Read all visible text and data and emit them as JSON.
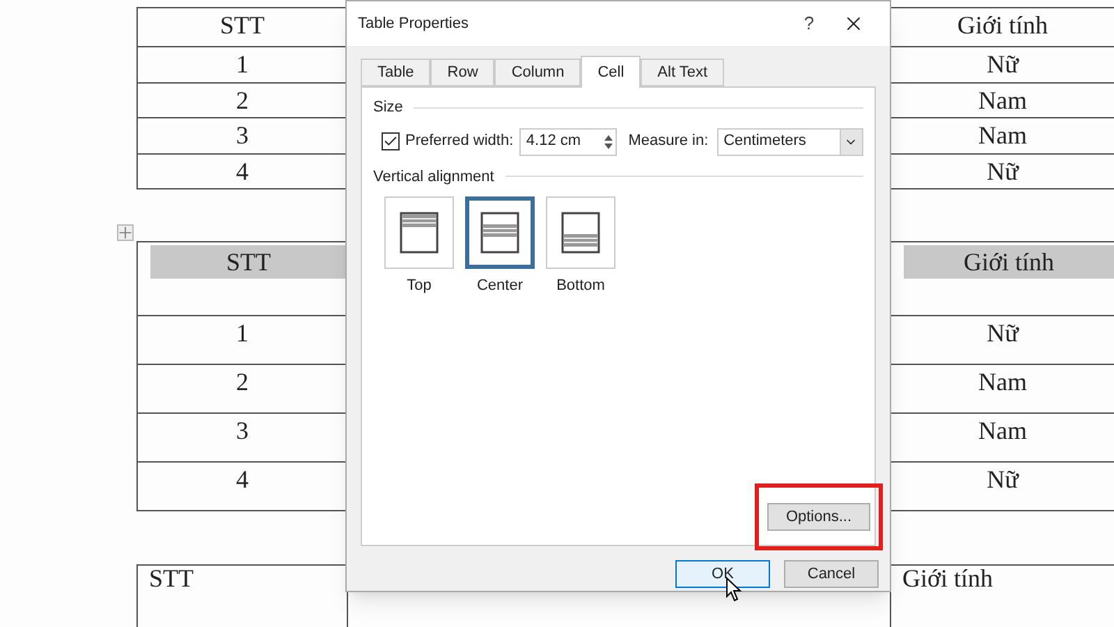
{
  "document": {
    "tables": [
      {
        "kind": "compact",
        "header_selected": false,
        "header": [
          "STT",
          "Giới tính"
        ],
        "rows": [
          [
            "1",
            "Nữ"
          ],
          [
            "2",
            "Nam"
          ],
          [
            "3",
            "Nam"
          ],
          [
            "4",
            "Nữ"
          ]
        ]
      },
      {
        "kind": "spaced",
        "header_selected": true,
        "header": [
          "STT",
          "Giới tính"
        ],
        "rows": [
          [
            "1",
            "Nữ"
          ],
          [
            "2",
            "Nam"
          ],
          [
            "3",
            "Nam"
          ],
          [
            "4",
            "Nữ"
          ]
        ]
      },
      {
        "kind": "top_left",
        "header_selected": false,
        "header": [
          "STT",
          "Giới tính"
        ]
      }
    ]
  },
  "dialog": {
    "title": "Table Properties",
    "help": "?",
    "tabs": [
      {
        "label": "Table",
        "selected": false
      },
      {
        "label": "Row",
        "selected": false
      },
      {
        "label": "Column",
        "selected": false
      },
      {
        "label": "Cell",
        "selected": true
      },
      {
        "label": "Alt Text",
        "selected": false
      }
    ],
    "size": {
      "heading": "Size",
      "preferred_width": {
        "label": "Preferred width:",
        "checked": true,
        "value": "4.12 cm"
      },
      "measure_in": {
        "label": "Measure in:",
        "value": "Centimeters"
      }
    },
    "vertical_alignment": {
      "heading": "Vertical alignment",
      "options": [
        {
          "kind": "top",
          "label": "Top",
          "selected": false
        },
        {
          "kind": "center",
          "label": "Center",
          "selected": true
        },
        {
          "kind": "bottom",
          "label": "Bottom",
          "selected": false
        }
      ]
    },
    "options_button": {
      "label": "Options...",
      "highlighted": true
    },
    "buttons": [
      {
        "label": "OK",
        "default": true
      },
      {
        "label": "Cancel",
        "default": false
      }
    ]
  }
}
